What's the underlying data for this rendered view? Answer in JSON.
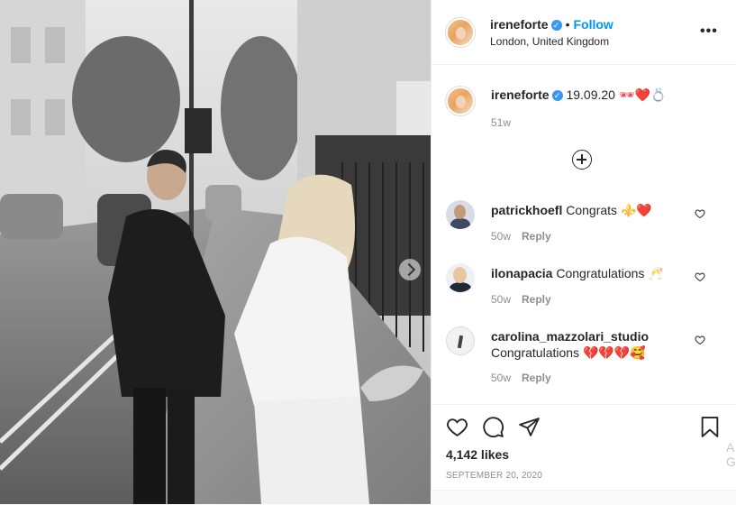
{
  "post": {
    "username": "ireneforte",
    "follow_label": "Follow",
    "separator": "•",
    "location": "London, United Kingdom",
    "more_icon": "more-options-icon",
    "more_glyph": "•••"
  },
  "caption": {
    "username": "ireneforte",
    "text": "19.09.20",
    "emojis": "🕶❤️💍",
    "age": "51w"
  },
  "comments": [
    {
      "username": "patrickhoefl",
      "text": "Congrats",
      "emojis": "⚜️❤️",
      "age": "50w",
      "reply_label": "Reply"
    },
    {
      "username": "ilonapacia",
      "text": "Congratulations",
      "emojis": "🥂",
      "age": "50w",
      "reply_label": "Reply"
    },
    {
      "username": "carolina_mazzolari_studio",
      "text": "Congratulations",
      "emojis": "💔💔💔🥰",
      "age": "50w",
      "reply_label": "Reply"
    }
  ],
  "actions": {
    "likes": "4,142 likes",
    "date": "SEPTEMBER 20, 2020"
  },
  "side_fragment": {
    "line1": "A",
    "line2": "Go"
  },
  "colors": {
    "accent": "#0095f6",
    "verified": "#3897f0",
    "like_red": "#ed4956",
    "muted": "#8e8e8e"
  }
}
